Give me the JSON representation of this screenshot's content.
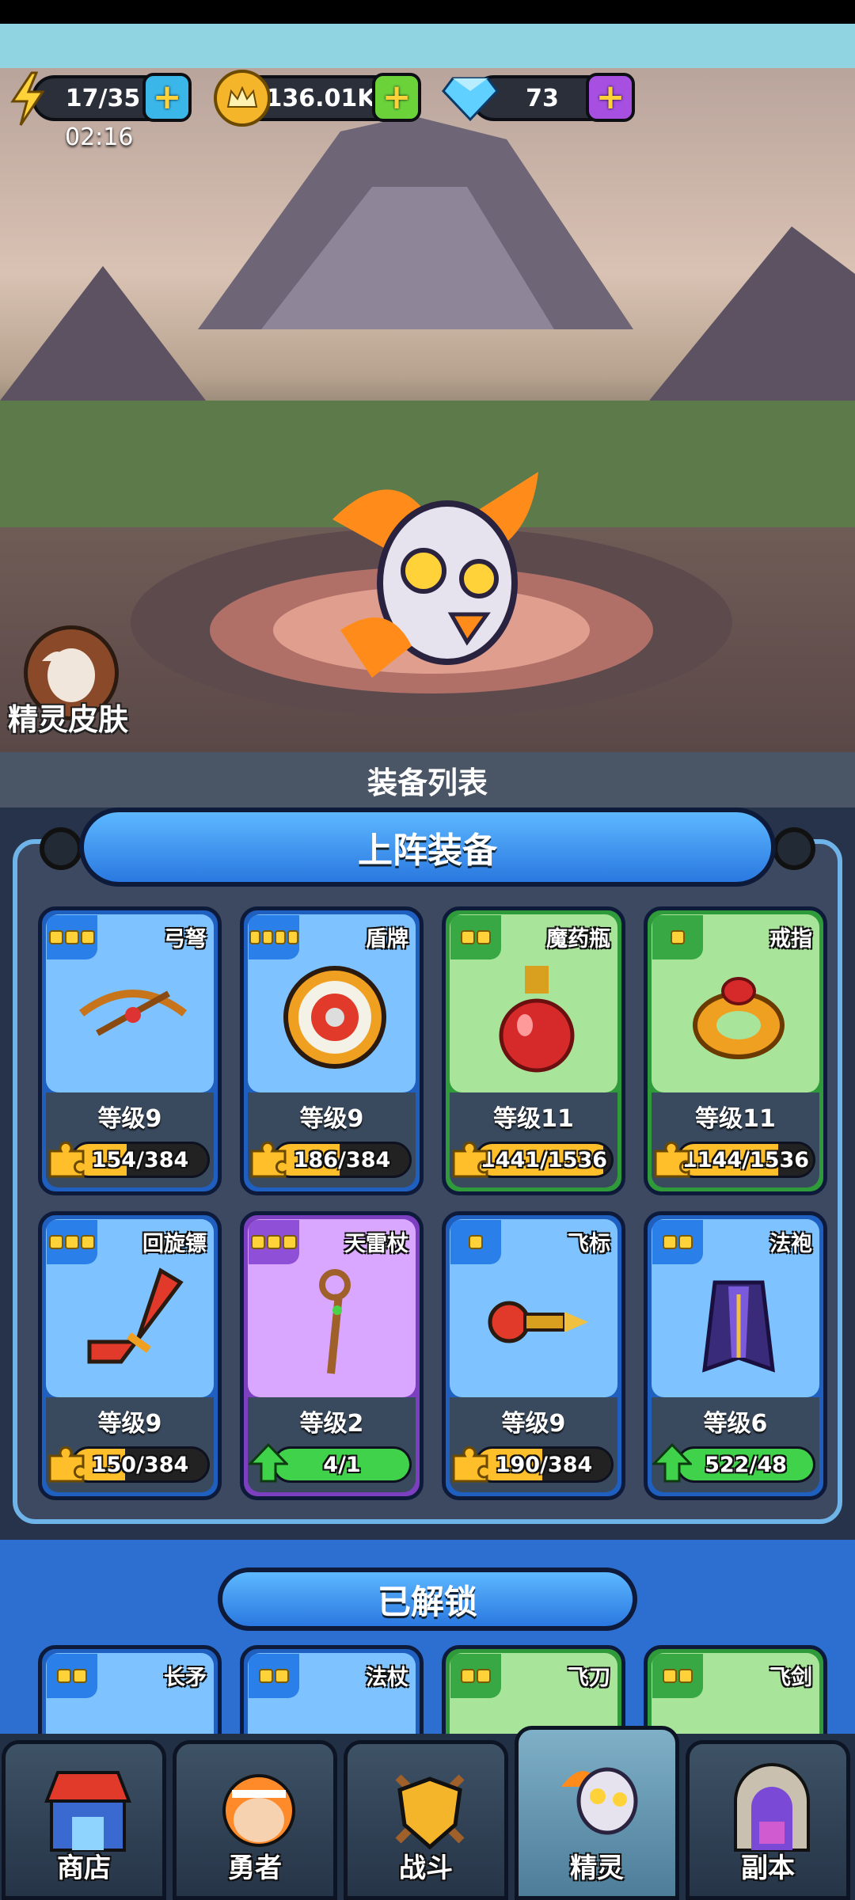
{
  "resources": {
    "energy": {
      "value": "17/35",
      "icon": "lightning-icon",
      "timer": "02:16"
    },
    "gold": {
      "value": "136.01K",
      "icon": "crown-coin-icon"
    },
    "gems": {
      "value": "73",
      "icon": "diamond-icon"
    }
  },
  "skin_button": {
    "label": "精灵皮肤"
  },
  "equipment_list": {
    "title": "装备列表"
  },
  "equipped": {
    "title": "上阵装备",
    "cards": [
      {
        "name": "弓弩",
        "level": "等级9",
        "progress": "154/384",
        "fill": 0.4,
        "rarity": "blue",
        "dots": 3
      },
      {
        "name": "盾牌",
        "level": "等级9",
        "progress": "186/384",
        "fill": 0.48,
        "rarity": "blue",
        "dots": 4
      },
      {
        "name": "魔药瓶",
        "level": "等级11",
        "progress": "1441/1536",
        "fill": 0.94,
        "rarity": "green",
        "dots": 2
      },
      {
        "name": "戒指",
        "level": "等级11",
        "progress": "1144/1536",
        "fill": 0.74,
        "rarity": "green",
        "dots": 1
      },
      {
        "name": "回旋镖",
        "level": "等级9",
        "progress": "150/384",
        "fill": 0.39,
        "rarity": "blue",
        "dots": 3
      },
      {
        "name": "天雷杖",
        "level": "等级2",
        "progress": "4/1",
        "fill": 1.0,
        "rarity": "purple",
        "dots": 3,
        "upgradable": true
      },
      {
        "name": "飞标",
        "level": "等级9",
        "progress": "190/384",
        "fill": 0.49,
        "rarity": "blue",
        "dots": 1
      },
      {
        "name": "法袍",
        "level": "等级6",
        "progress": "522/48",
        "fill": 1.0,
        "rarity": "blue",
        "dots": 2,
        "upgradable": true
      }
    ]
  },
  "unlocked": {
    "title": "已解锁",
    "cards": [
      {
        "name": "长矛",
        "rarity": "blue"
      },
      {
        "name": "法杖",
        "rarity": "blue"
      },
      {
        "name": "飞刀",
        "rarity": "green"
      },
      {
        "name": "飞剑",
        "rarity": "green"
      }
    ]
  },
  "nav": [
    {
      "label": "商店",
      "icon": "shop-icon"
    },
    {
      "label": "勇者",
      "icon": "hero-icon"
    },
    {
      "label": "战斗",
      "icon": "battle-shield-icon"
    },
    {
      "label": "精灵",
      "icon": "spirit-icon",
      "active": true
    },
    {
      "label": "副本",
      "icon": "dungeon-door-icon"
    }
  ],
  "colors": {
    "accent_blue": "#2a78e0",
    "gold": "#ffbf2a",
    "upgrade_green": "#3fd24a"
  }
}
